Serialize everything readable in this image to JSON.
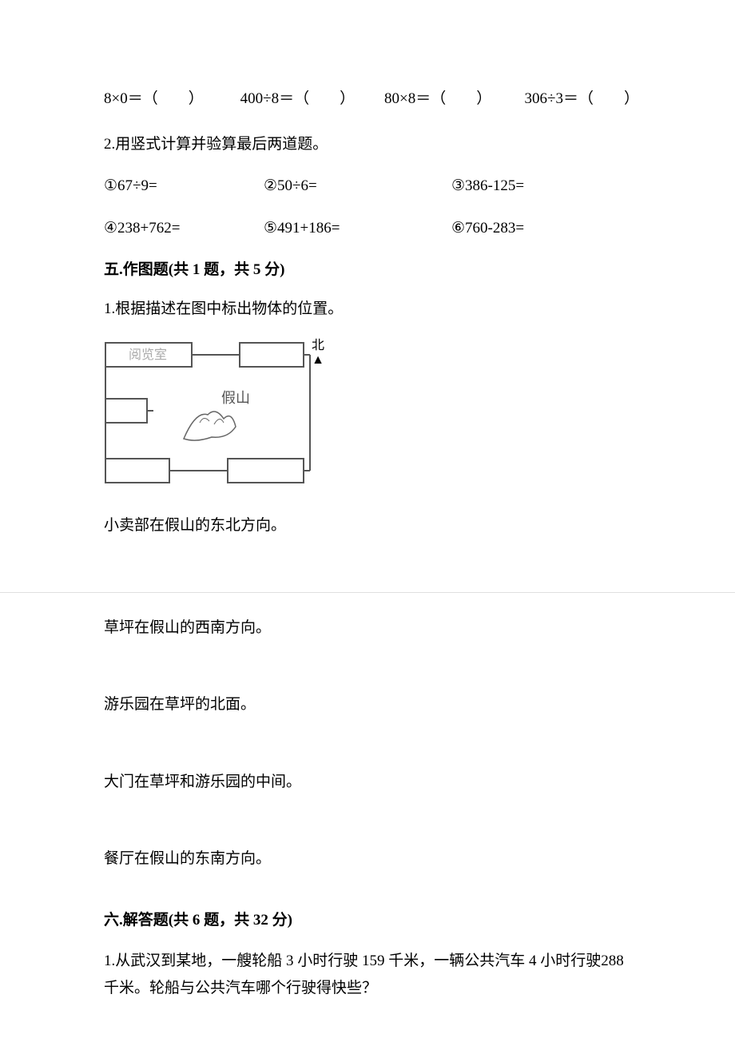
{
  "section4": {
    "row1": {
      "eq1": "8×0＝（　　）",
      "eq2": "400÷8＝（　　）",
      "eq3": "80×8＝（　　）",
      "eq4": "306÷3＝（　　）"
    },
    "q2_title": "2.用竖式计算并验算最后两道题。",
    "q2_row1": {
      "c1": "①67÷9=",
      "c2": "②50÷6=",
      "c3": "③386-125="
    },
    "q2_row2": {
      "c1": "④238+762=",
      "c2": "⑤491+186=",
      "c3": "⑥760-283="
    }
  },
  "section5": {
    "header": "五.作图题(共 1 题，共 5 分)",
    "q1": "1.根据描述在图中标出物体的位置。",
    "diagram": {
      "top_left_label": "阅览室",
      "center_label": "假山",
      "north_label_top": "北",
      "north_label_bottom": "▲"
    },
    "d1": "小卖部在假山的东北方向。",
    "d2": "草坪在假山的西南方向。",
    "d3": "游乐园在草坪的北面。",
    "d4": "大门在草坪和游乐园的中间。",
    "d5": "餐厅在假山的东南方向。"
  },
  "section6": {
    "header": "六.解答题(共 6 题，共 32 分)",
    "q1": "1.从武汉到某地，一艘轮船 3 小时行驶 159 千米，一辆公共汽车 4 小时行驶288 千米。轮船与公共汽车哪个行驶得快些？"
  }
}
